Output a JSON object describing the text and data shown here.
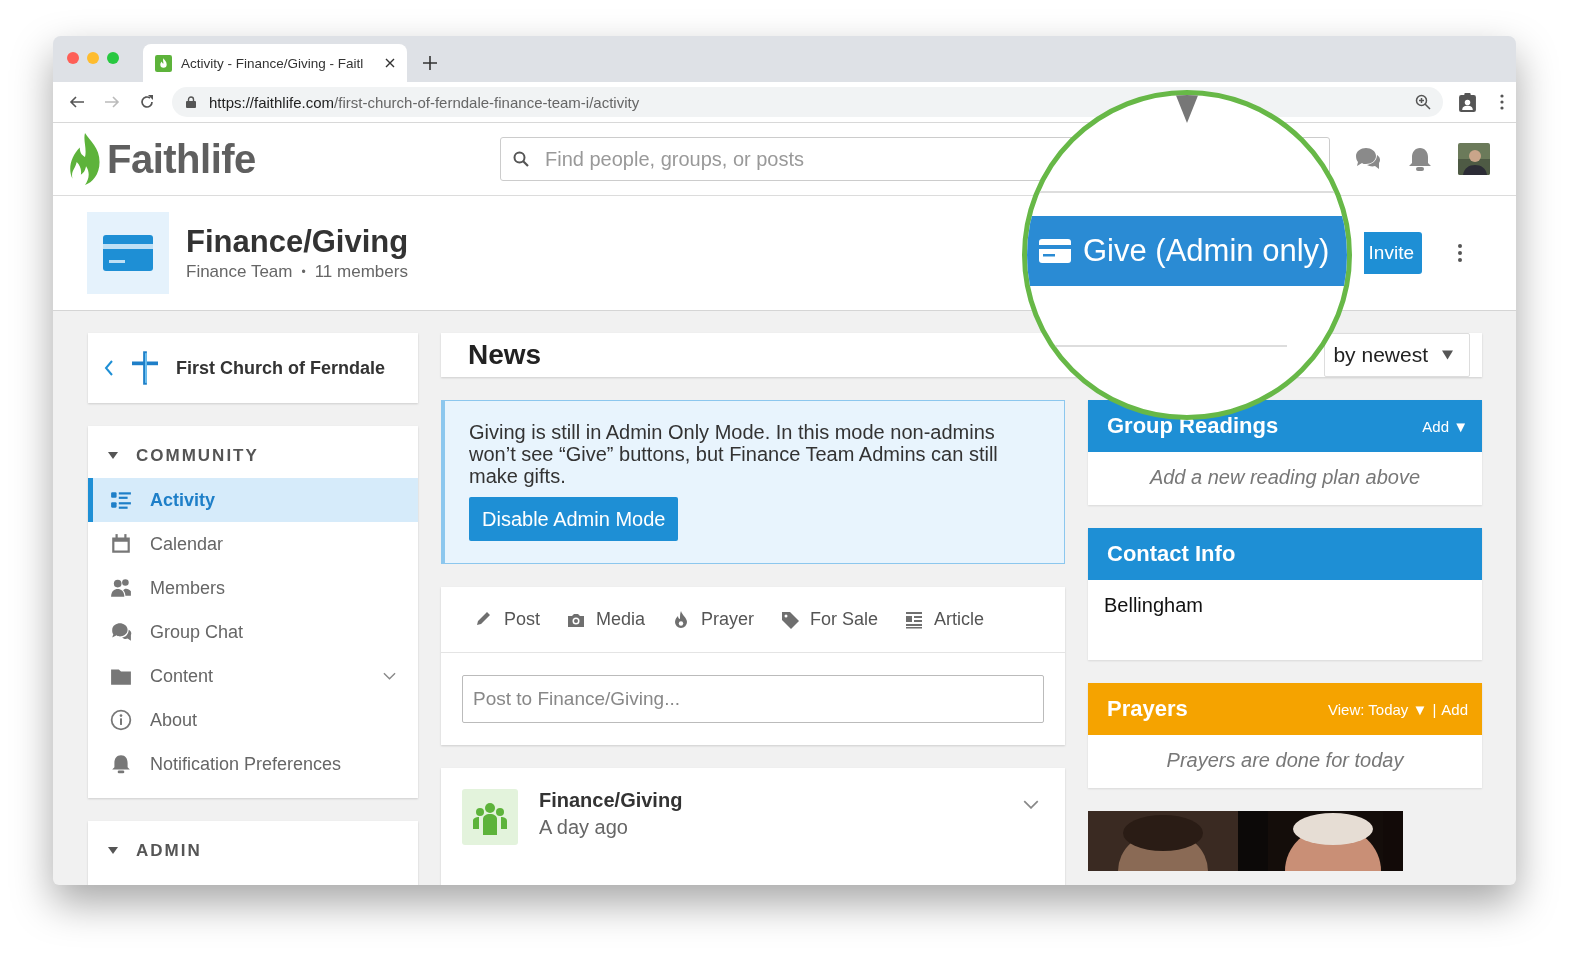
{
  "browser": {
    "tab_title": "Activity - Finance/Giving - Faitl",
    "url_host": "https://faithlife.com",
    "url_path": "/first-church-of-ferndale-finance-team-i/activity"
  },
  "app": {
    "logo": "Faithlife",
    "search": {
      "placeholder": "Find people, groups, or posts"
    }
  },
  "group": {
    "name": "Finance/Giving",
    "team": "Finance Team",
    "separator": "•",
    "members": "11 members",
    "give_button": "Give (Admin only)",
    "invite_button": "Invite"
  },
  "sidebar": {
    "parent": "First Church of Ferndale",
    "sections": [
      {
        "title": "COMMUNITY",
        "expanded": true,
        "items": [
          {
            "label": "Activity",
            "selected": true,
            "has_children": false
          },
          {
            "label": "Calendar",
            "selected": false,
            "has_children": false
          },
          {
            "label": "Members",
            "selected": false,
            "has_children": false
          },
          {
            "label": "Group Chat",
            "selected": false,
            "has_children": false
          },
          {
            "label": "Content",
            "selected": false,
            "has_children": true
          },
          {
            "label": "About",
            "selected": false,
            "has_children": false
          },
          {
            "label": "Notification Preferences",
            "selected": false,
            "has_children": false
          }
        ]
      },
      {
        "title": "ADMIN",
        "expanded": true
      }
    ]
  },
  "news": {
    "title": "News",
    "sort": "by newest"
  },
  "notice": {
    "text": "Giving is still in Admin Only Mode. In this mode non-admins won’t see “Give” buttons, but Finance Team Admins can still make gifts.",
    "button": "Disable Admin Mode"
  },
  "composer": {
    "tabs": [
      "Post",
      "Media",
      "Prayer",
      "For Sale",
      "Article"
    ],
    "placeholder": "Post to Finance/Giving..."
  },
  "post": {
    "author": "Finance/Giving",
    "time": "A day ago"
  },
  "widgets": [
    {
      "title": "Group Readings",
      "color": "#1e8fd5",
      "actions": [
        "Add ▼"
      ],
      "body": "Add a new reading plan above",
      "empty": true
    },
    {
      "title": "Contact Info",
      "color": "#1e8fd5",
      "body": "Bellingham",
      "empty": false
    },
    {
      "title": "Prayers",
      "color": "#f5a300",
      "actions": [
        "View: Today ▼",
        "|",
        "Add"
      ],
      "body": "Prayers are done for today",
      "empty": true
    }
  ]
}
